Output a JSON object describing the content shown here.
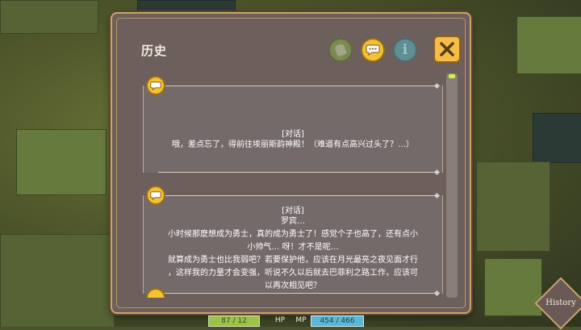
{
  "window": {
    "title": "历史",
    "buttons": [
      {
        "name": "voice-button",
        "icon": "hand-icon"
      },
      {
        "name": "dialogue-button",
        "icon": "speech-bubble-icon"
      },
      {
        "name": "info-button",
        "icon": "info-icon",
        "label": "i"
      }
    ],
    "close_icon": "close-icon"
  },
  "entries": [
    {
      "icon": "speech-bubble-icon",
      "speaker": "[对话]",
      "lines": [
        "哦，差点忘了，得前往埃丽斯韵神殿！（难道有点高兴过头了？…）"
      ]
    },
    {
      "icon": "speech-bubble-icon",
      "speaker": "[对话]",
      "lines": [
        "罗宾…",
        "小时候那麽想成为勇士，真的成为勇士了！感觉个子也高了，还有点小",
        "小帅气… 呀！才不是呢…",
        "就算成为勇士也比我弱吧？若要保护他，应该在月光最亮之夜见面才行",
        "，这样我的力量才会变强，听说不久以后就去巴菲利之路工作，应该可",
        "以再次相见吧？"
      ]
    }
  ],
  "scrollbar": {
    "position": 0
  },
  "hud": {
    "hp_value": "87 / 12",
    "hp_label": "HP",
    "mp_label": "MP",
    "mp_value": "454 / 466",
    "history_label": "History"
  },
  "colors": {
    "panel": "#6d5f5c",
    "frame": "#c9a36b",
    "accent_yellow": "#f2c232",
    "hp": "#9dc24a",
    "mp": "#5ab8d6"
  }
}
